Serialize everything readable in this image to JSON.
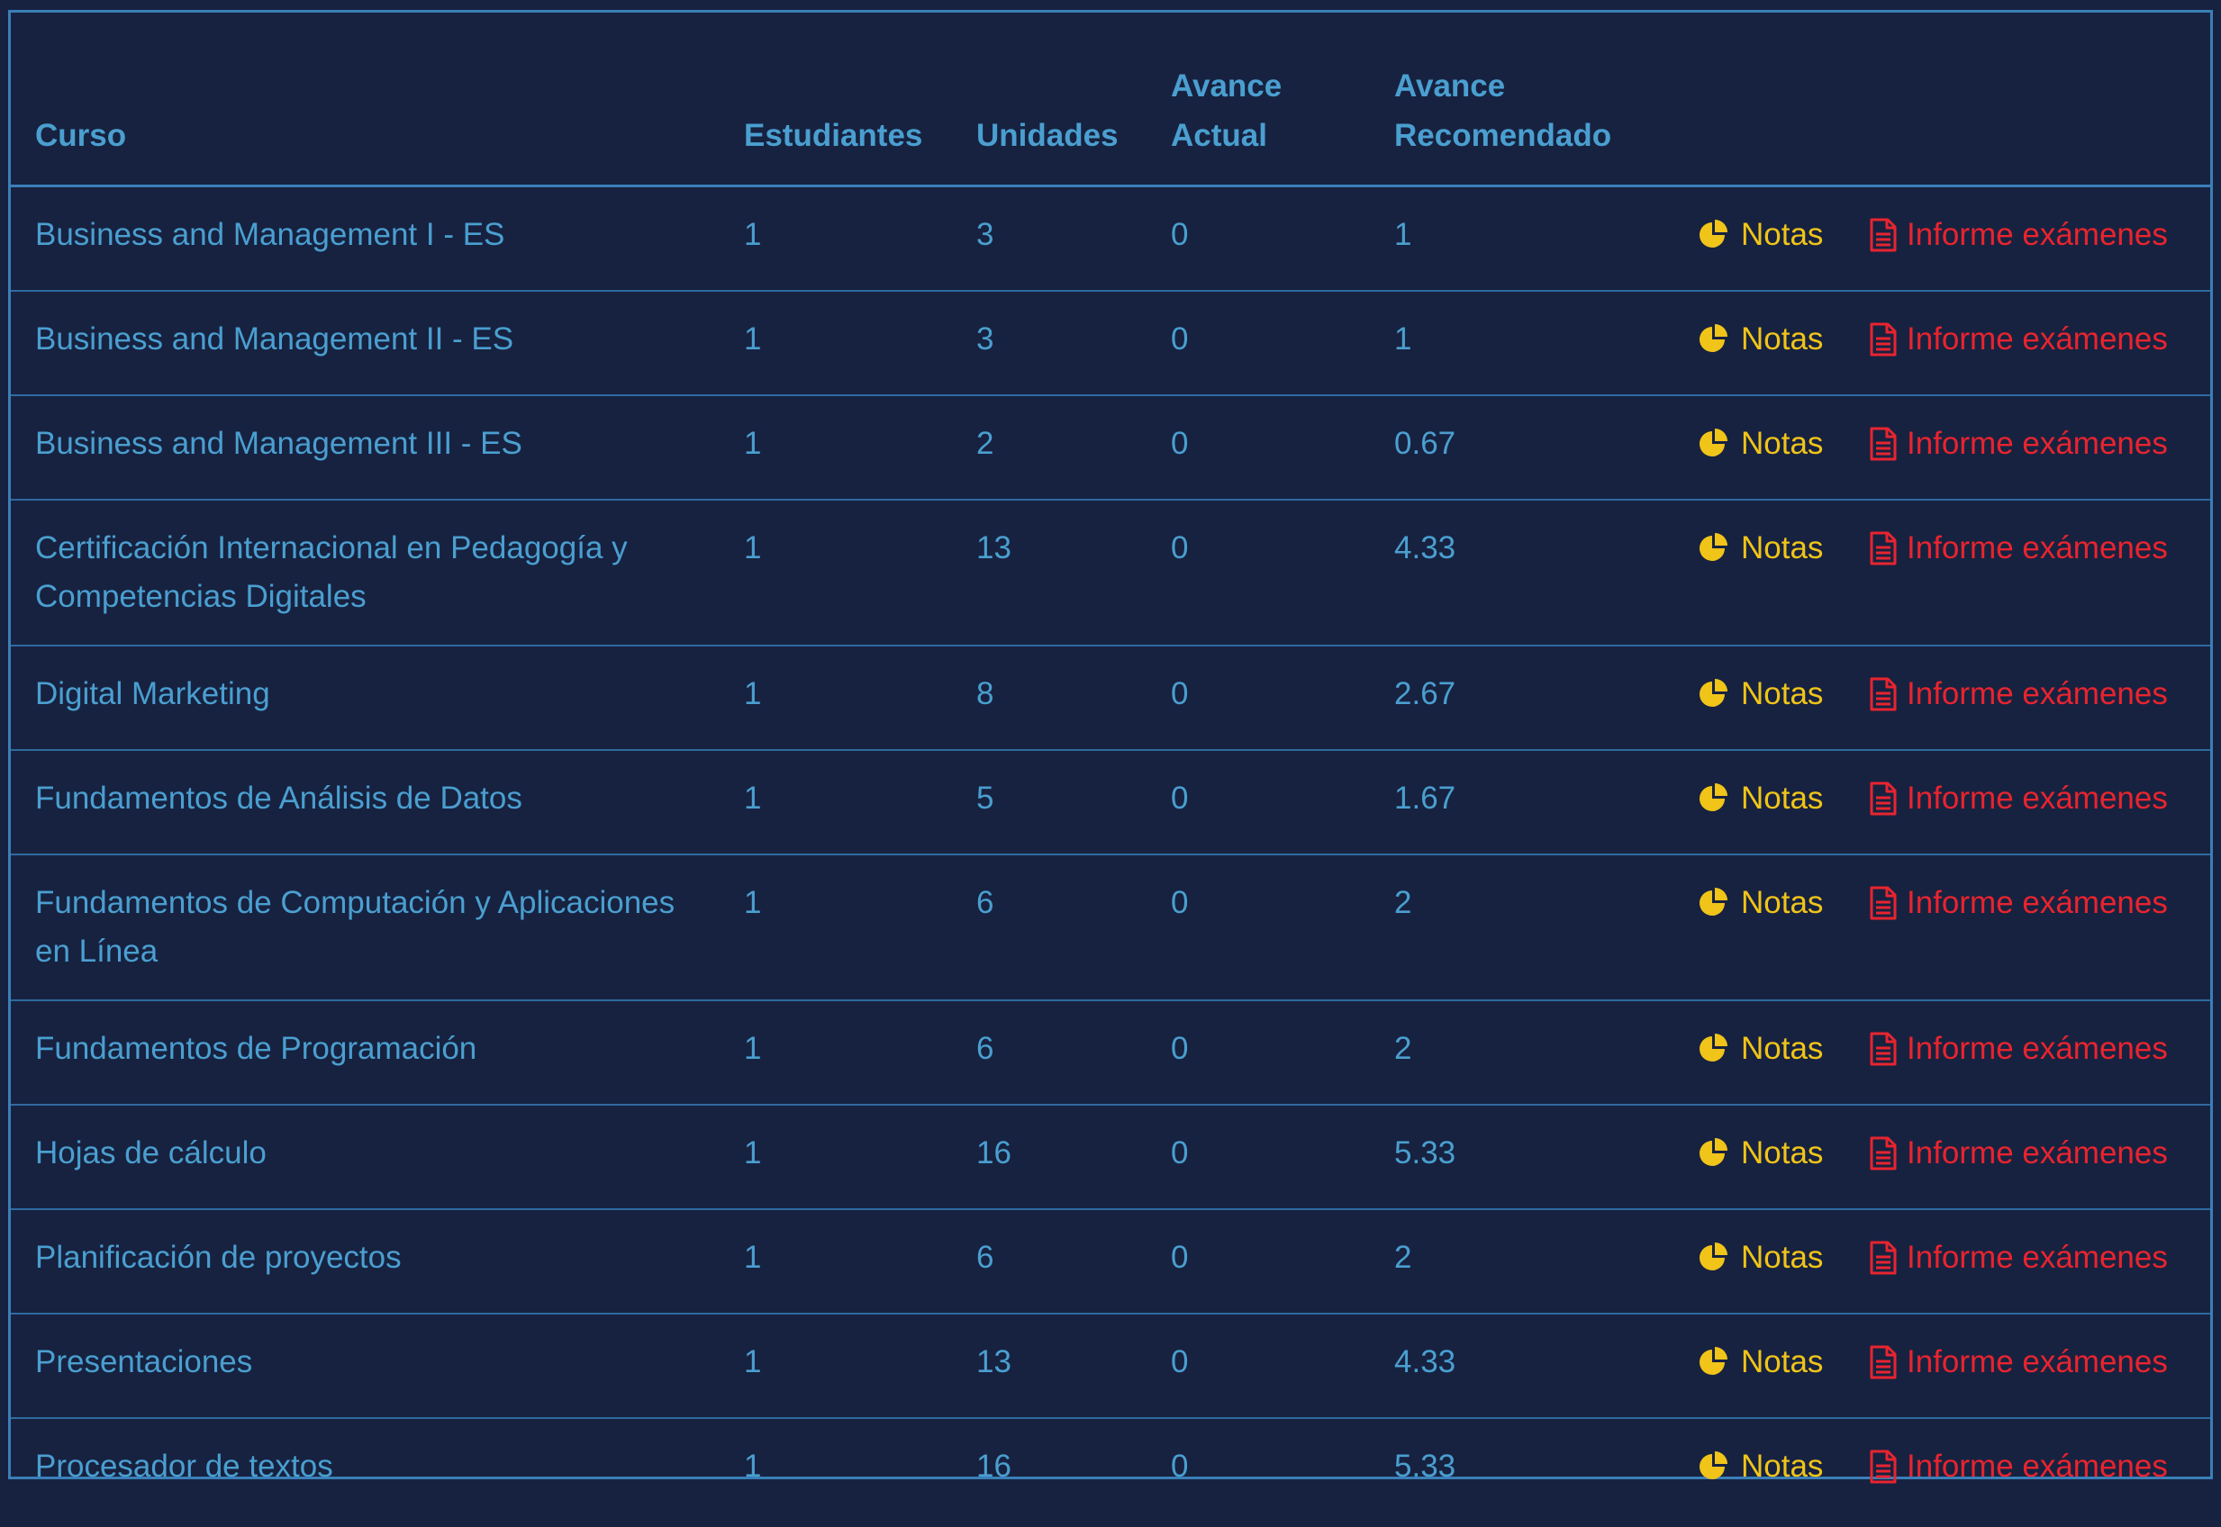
{
  "table": {
    "headers": {
      "course": "Curso",
      "students": "Estudiantes",
      "units": "Unidades",
      "current_line1": "Avance",
      "current_line2": "Actual",
      "recommended_line1": "Avance",
      "recommended_line2": "Recomendado"
    },
    "actions": {
      "notes_label": "Notas",
      "report_label": "Informe exámenes",
      "notes_icon": "pie-chart-icon",
      "report_icon": "file-text-icon"
    },
    "rows": [
      {
        "course": "Business and Management I - ES",
        "students": "1",
        "units": "3",
        "current": "0",
        "recommended": "1"
      },
      {
        "course": "Business and Management II - ES",
        "students": "1",
        "units": "3",
        "current": "0",
        "recommended": "1"
      },
      {
        "course": "Business and Management III - ES",
        "students": "1",
        "units": "2",
        "current": "0",
        "recommended": "0.67"
      },
      {
        "course": "Certificación Internacional en Pedagogía y Competencias Digitales",
        "students": "1",
        "units": "13",
        "current": "0",
        "recommended": "4.33"
      },
      {
        "course": "Digital Marketing",
        "students": "1",
        "units": "8",
        "current": "0",
        "recommended": "2.67"
      },
      {
        "course": "Fundamentos de Análisis de Datos",
        "students": "1",
        "units": "5",
        "current": "0",
        "recommended": "1.67"
      },
      {
        "course": "Fundamentos de Computación y Aplicaciones en Línea",
        "students": "1",
        "units": "6",
        "current": "0",
        "recommended": "2"
      },
      {
        "course": "Fundamentos de Programación",
        "students": "1",
        "units": "6",
        "current": "0",
        "recommended": "2"
      },
      {
        "course": "Hojas de cálculo",
        "students": "1",
        "units": "16",
        "current": "0",
        "recommended": "5.33"
      },
      {
        "course": "Planificación de proyectos",
        "students": "1",
        "units": "6",
        "current": "0",
        "recommended": "2"
      },
      {
        "course": "Presentaciones",
        "students": "1",
        "units": "13",
        "current": "0",
        "recommended": "4.33"
      },
      {
        "course": "Procesador de textos",
        "students": "1",
        "units": "16",
        "current": "0",
        "recommended": "5.33"
      }
    ]
  },
  "colors": {
    "background": "#172240",
    "text": "#4a9fd0",
    "border": "#3a7fb8",
    "notes": "#f0c419",
    "report": "#e8242f"
  }
}
